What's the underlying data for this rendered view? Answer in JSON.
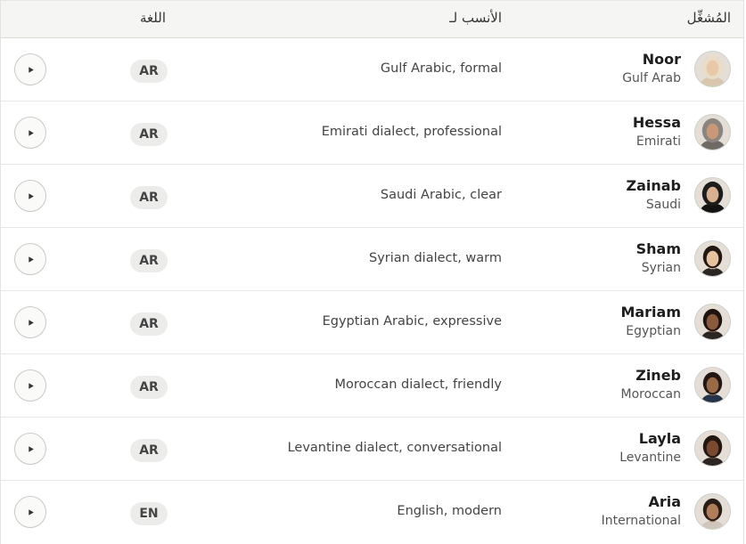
{
  "header": {
    "operator_label": "المُشغِّل",
    "best_for_label": "الأنسب لـ",
    "language_label": "اللغة"
  },
  "rows": [
    {
      "name": "Noor",
      "region": "Gulf Arab",
      "description": "Gulf Arabic, formal",
      "language": "AR",
      "avatar": "hijab-light"
    },
    {
      "name": "Hessa",
      "region": "Emirati",
      "description": "Emirati dialect, professional",
      "language": "AR",
      "avatar": "hijab-grey"
    },
    {
      "name": "Zainab",
      "region": "Saudi",
      "description": "Saudi Arabic, clear",
      "language": "AR",
      "avatar": "hijab-black"
    },
    {
      "name": "Sham",
      "region": "Syrian",
      "description": "Syrian dialect, warm",
      "language": "AR",
      "avatar": "hair-dark"
    },
    {
      "name": "Mariam",
      "region": "Egyptian",
      "description": "Egyptian Arabic, expressive",
      "language": "AR",
      "avatar": "hair-curly"
    },
    {
      "name": "Zineb",
      "region": "Moroccan",
      "description": "Moroccan dialect, friendly",
      "language": "AR",
      "avatar": "hair-blazer"
    },
    {
      "name": "Layla",
      "region": "Levantine",
      "description": "Levantine dialect, conversational",
      "language": "AR",
      "avatar": "hair-long"
    },
    {
      "name": "Aria",
      "region": "International",
      "description": "English, modern",
      "language": "EN",
      "avatar": "hair-tied"
    }
  ],
  "icons": {
    "play": "play-icon"
  }
}
